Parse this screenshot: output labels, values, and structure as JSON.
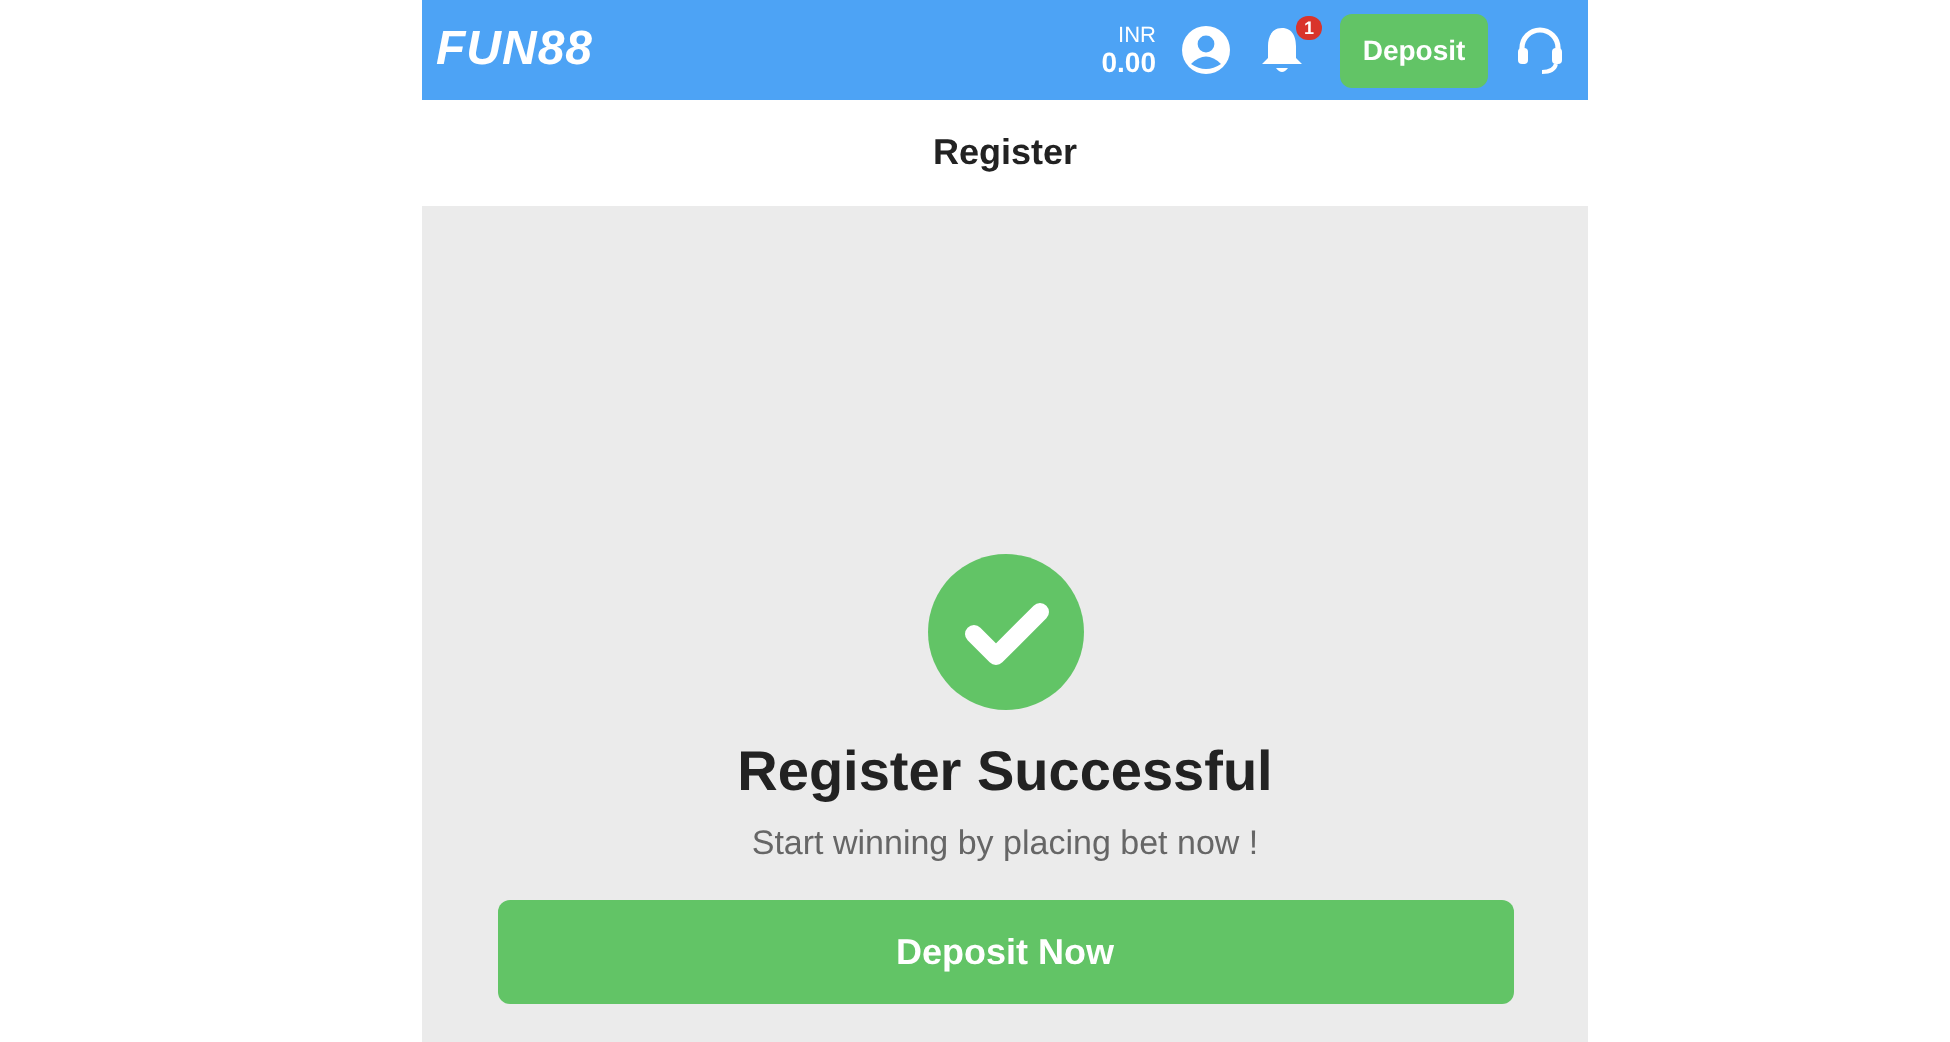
{
  "header": {
    "logo": "FUN88",
    "currency": "INR",
    "balance": "0.00",
    "notification_count": "1",
    "deposit_button": "Deposit"
  },
  "page_title": "Register",
  "success": {
    "title": "Register Successful",
    "message": "Start winning by placing bet now !",
    "button": "Deposit Now"
  }
}
